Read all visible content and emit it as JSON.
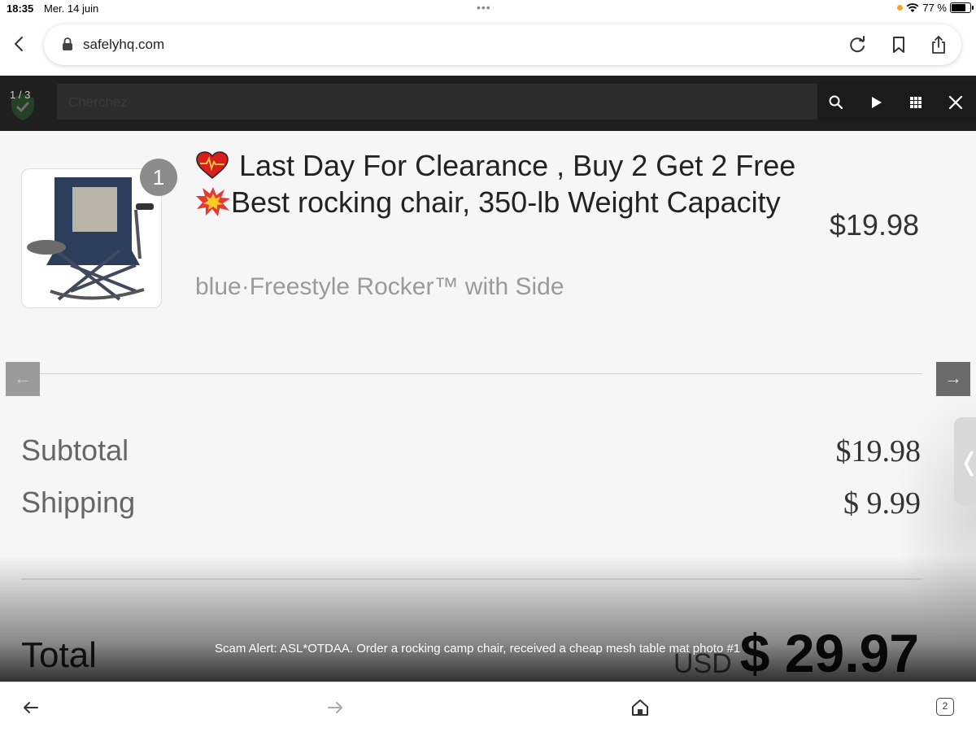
{
  "status_bar": {
    "time": "18:35",
    "date": "Mer. 14 juin",
    "battery_text": "77 %",
    "battery_level": 0.77,
    "dots": "•••"
  },
  "browser": {
    "url": "safelyhq.com",
    "tab_count": "2"
  },
  "viewer": {
    "counter": "1 / 3",
    "search_placeholder": "Cherchez",
    "caption": "Scam Alert: ASL*OTDAA. Order a rocking camp chair, received a cheap mesh table mat photo #1",
    "colors": {
      "bar": "#1f1f1f",
      "overlay": "#000000"
    }
  },
  "order": {
    "quantity": "1",
    "title_part1": "Last Day For Clearance , Buy 2 Get 2 Free",
    "title_part2": "Best rocking chair, 350-lb Weight Capacity",
    "variant": "blue·Freestyle Rocker™ with Side",
    "price": "$19.98",
    "subtotal_label": "Subtotal",
    "subtotal_value": "$19.98",
    "shipping_label": "Shipping",
    "shipping_value": "$ 9.99",
    "total_label": "Total",
    "currency": "USD",
    "total_value": "$ 29.97",
    "prev_arrow": "←",
    "next_arrow": "→",
    "side_chevron": "❬"
  }
}
